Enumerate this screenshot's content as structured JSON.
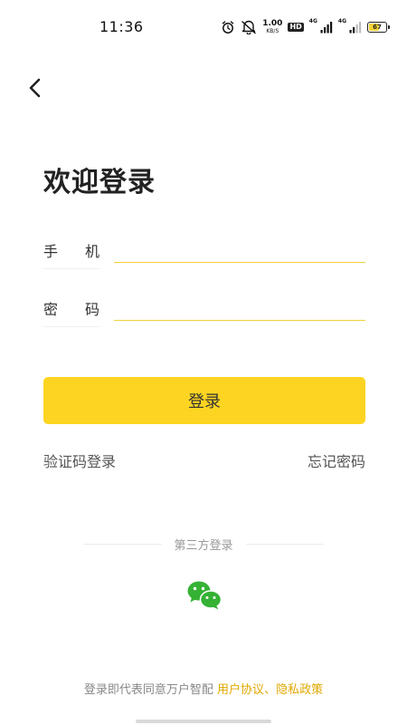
{
  "status_bar": {
    "time": "11:36",
    "net_speed_value": "1.00",
    "net_speed_unit": "KB/S",
    "hd_label": "HD",
    "network_type_1": "4G",
    "network_type_2": "4G",
    "battery_level": "67",
    "battery_fraction": 0.67,
    "icons": [
      "alarm-icon",
      "mute-icon",
      "signal-icon",
      "signal-icon"
    ]
  },
  "header": {
    "back_icon": "chevron-left-icon",
    "title": "欢迎登录"
  },
  "form": {
    "phone_label": [
      "手",
      "机"
    ],
    "phone_value": "",
    "password_label": [
      "密",
      "码"
    ],
    "password_value": ""
  },
  "actions": {
    "login_label": "登录",
    "sms_login_label": "验证码登录",
    "forgot_password_label": "忘记密码"
  },
  "third_party": {
    "divider_label": "第三方登录",
    "wechat_icon": "wechat-icon"
  },
  "agreement": {
    "prefix": "登录即代表同意万户智配",
    "user_agreement": "用户协议",
    "separator": "、",
    "privacy_policy": "隐私政策"
  },
  "colors": {
    "accent": "#fdd422",
    "input_underline": "#f2d13a",
    "link": "#e0a800",
    "wechat_green": "#35b234"
  }
}
